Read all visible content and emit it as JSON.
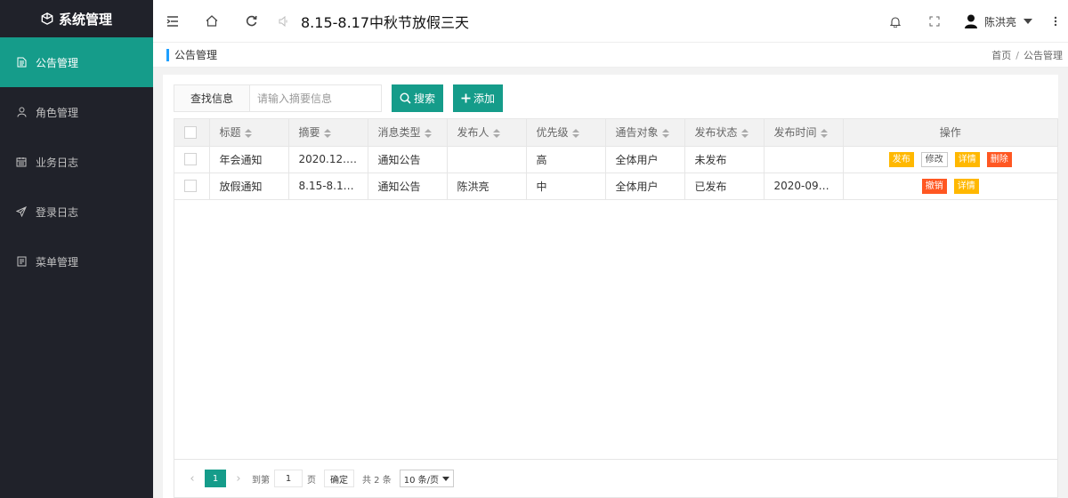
{
  "app": {
    "title": "系统管理"
  },
  "sidebar": {
    "items": [
      {
        "label": "公告管理",
        "icon": "document-icon",
        "active": true
      },
      {
        "label": "角色管理",
        "icon": "user-icon",
        "active": false
      },
      {
        "label": "业务日志",
        "icon": "calendar-icon",
        "active": false
      },
      {
        "label": "登录日志",
        "icon": "send-icon",
        "active": false
      },
      {
        "label": "菜单管理",
        "icon": "list-icon",
        "active": false
      }
    ]
  },
  "header": {
    "marquee": "8.15-8.17中秋节放假三天",
    "user": "陈洪亮"
  },
  "bar": {
    "title": "公告管理",
    "breadcrumb": [
      "首页",
      "公告管理"
    ]
  },
  "toolbar": {
    "search_label": "查找信息",
    "search_placeholder": "请输入摘要信息",
    "search_button": "搜索",
    "add_button": "添加"
  },
  "table": {
    "columns": [
      "标题",
      "摘要",
      "消息类型",
      "发布人",
      "优先级",
      "通告对象",
      "发布状态",
      "发布时间",
      "操作"
    ],
    "rows": [
      {
        "title": "年会通知",
        "summary": "2020.12.3...",
        "type": "通知公告",
        "publisher": "",
        "priority": "高",
        "target": "全体用户",
        "status": "未发布",
        "time": "",
        "actions": [
          {
            "label": "发布",
            "style": "warn"
          },
          {
            "label": "修改",
            "style": "plain"
          },
          {
            "label": "详情",
            "style": "warn"
          },
          {
            "label": "删除",
            "style": "danger"
          }
        ]
      },
      {
        "title": "放假通知",
        "summary": "8.15-8.17...",
        "type": "通知公告",
        "publisher": "陈洪亮",
        "priority": "中",
        "target": "全体用户",
        "status": "已发布",
        "time": "2020-09-2...",
        "actions": [
          {
            "label": "撤销",
            "style": "danger"
          },
          {
            "label": "详情",
            "style": "warn"
          }
        ]
      }
    ]
  },
  "pager": {
    "current": "1",
    "goto_prefix": "到第",
    "goto_value": "1",
    "goto_suffix": "页",
    "confirm": "确定",
    "total": "共 2 条",
    "limit": "10 条/页"
  },
  "colors": {
    "accent": "#159c8a",
    "sidebar": "#20222a",
    "warn": "#ffb800",
    "danger": "#ff5722"
  }
}
